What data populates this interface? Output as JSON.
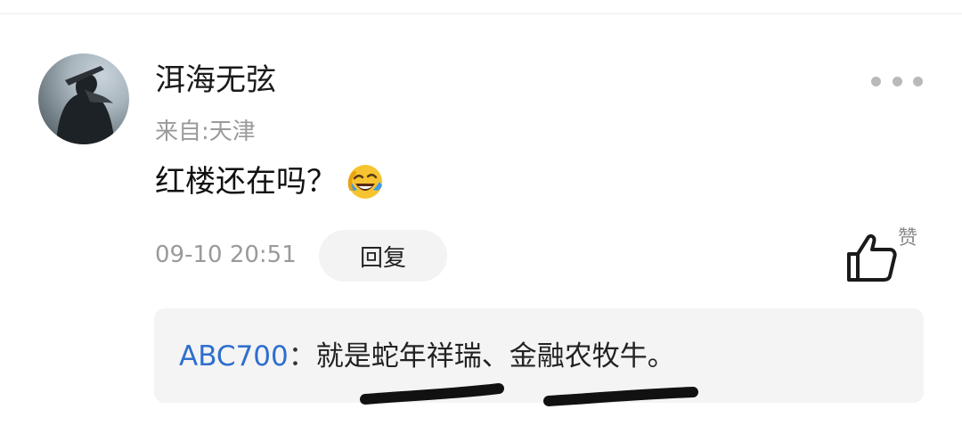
{
  "comment": {
    "username": "洱海无弦",
    "location": "来自:天津",
    "text": "红楼还在吗？",
    "emoji": "face-with-tears-of-joy-icon",
    "timestamp": "09-10 20:51",
    "reply_label": "回复",
    "like_label": "赞"
  },
  "reply_quote": {
    "user": "ABC700",
    "separator": "：",
    "text": "就是蛇年祥瑞、金融农牧牛。"
  },
  "colors": {
    "link_blue": "#2e6fcf",
    "secondary_text": "#9a9a9a",
    "quote_bg": "#f4f4f4",
    "redaction": "#111111"
  }
}
